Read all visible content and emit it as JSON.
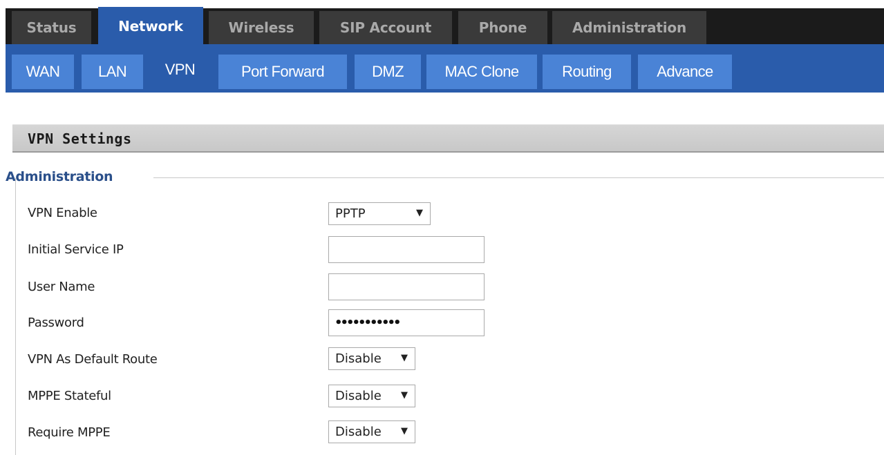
{
  "main_tabs": [
    {
      "label": "Status"
    },
    {
      "label": "Network"
    },
    {
      "label": "Wireless"
    },
    {
      "label": "SIP Account"
    },
    {
      "label": "Phone"
    },
    {
      "label": "Administration"
    }
  ],
  "sub_tabs": [
    {
      "label": "WAN"
    },
    {
      "label": "LAN"
    },
    {
      "label": "VPN"
    },
    {
      "label": "Port Forward"
    },
    {
      "label": "DMZ"
    },
    {
      "label": "MAC Clone"
    },
    {
      "label": "Routing"
    },
    {
      "label": "Advance"
    }
  ],
  "section": {
    "title": "VPN Settings"
  },
  "fieldset": {
    "legend": "Administration"
  },
  "fields": {
    "vpn_enable": {
      "label": "VPN Enable",
      "value": "PPTP"
    },
    "initial_service_ip": {
      "label": "Initial Service IP",
      "value": ""
    },
    "user_name": {
      "label": "User Name",
      "value": ""
    },
    "password": {
      "label": "Password",
      "value": "•••••••••••"
    },
    "vpn_default_route": {
      "label": "VPN As Default Route",
      "value": "Disable"
    },
    "mppe_stateful": {
      "label": "MPPE Stateful",
      "value": "Disable"
    },
    "require_mppe": {
      "label": "Require MPPE",
      "value": "Disable"
    }
  },
  "icons": {
    "dropdown": "▼"
  },
  "colors": {
    "accent": "#2a5cab",
    "subtab": "#4a83d6",
    "topbar": "#1b1b1b"
  }
}
